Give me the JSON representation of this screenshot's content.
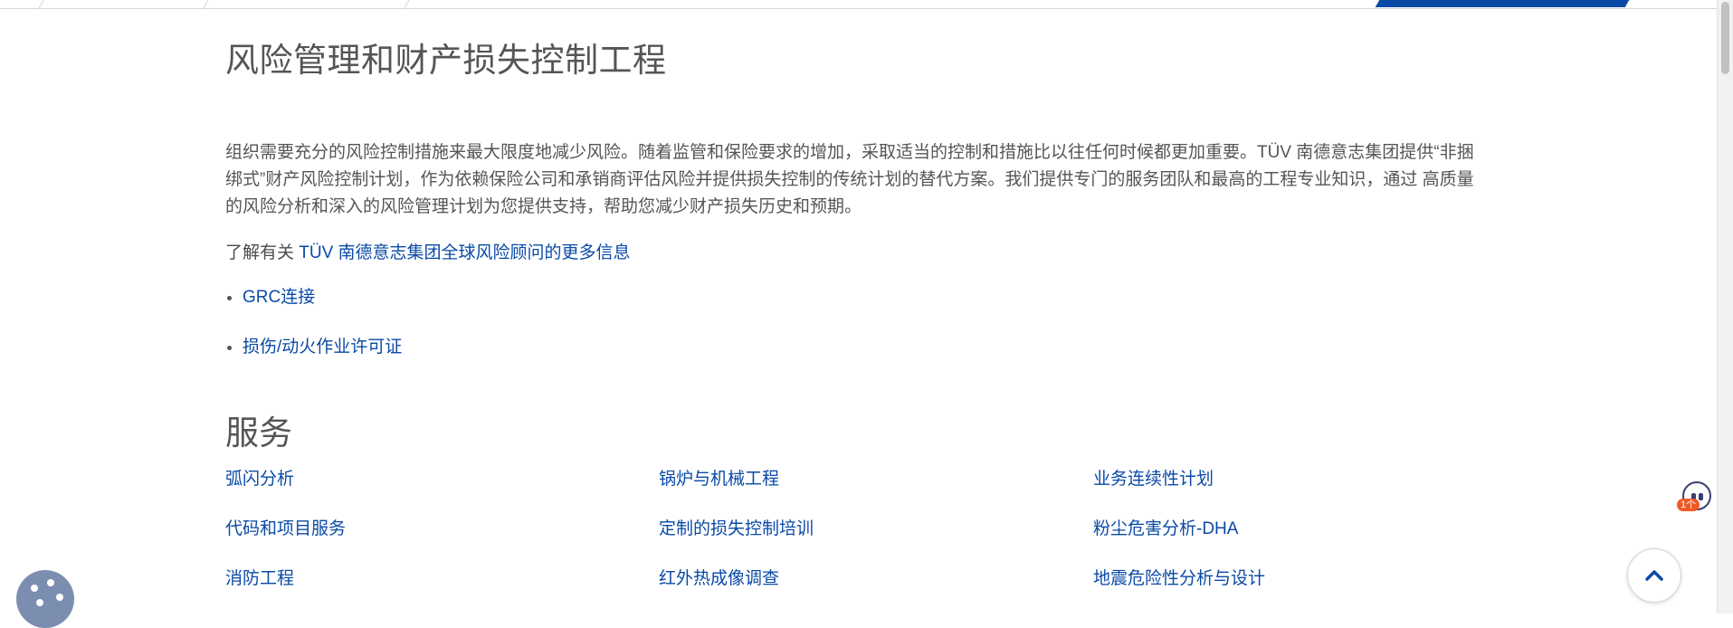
{
  "page": {
    "title": "风险管理和财产损失控制工程",
    "intro": "组织需要充分的风险控制措施来最大限度地减少风险。随着监管和保险要求的增加，采取适当的控制和措施比以往任何时候都更加重要。TÜV 南德意志集团提供“非捆绑式”财产风险控制计划，作为依赖保险公司和承销商评估风险并提供损失控制的传统计划的替代方案。我们提供专门的服务团队和最高的工程专业知识，通过  高质量的风险分析和深入的风险管理计划为您提供支持，帮助您减少财产损失历史和预期。",
    "learn_more_prefix": "了解有关 ",
    "learn_more_link": "TÜV 南德意志集团全球风险顾问的更多信息",
    "links": [
      {
        "label": "GRC连接"
      },
      {
        "label": "损伤/动火作业许可证"
      }
    ]
  },
  "services": {
    "title": "服务",
    "items": [
      {
        "label": "弧闪分析"
      },
      {
        "label": "锅炉与机械工程"
      },
      {
        "label": "业务连续性计划"
      },
      {
        "label": "代码和项目服务"
      },
      {
        "label": "定制的损失控制培训"
      },
      {
        "label": "粉尘危害分析-DHA"
      },
      {
        "label": "消防工程"
      },
      {
        "label": "红外热成像调查"
      },
      {
        "label": "地震危险性分析与设计"
      }
    ]
  },
  "widgets": {
    "chat_badge": "1个",
    "chat_icon": "chat-assistant-icon",
    "cookie_icon": "cookie-icon",
    "back_to_top_icon": "chevron-up-icon"
  },
  "colors": {
    "link": "#0a4aa6",
    "text": "#555555",
    "active_tab": "#0a4aa6",
    "badge": "#f15a24"
  }
}
